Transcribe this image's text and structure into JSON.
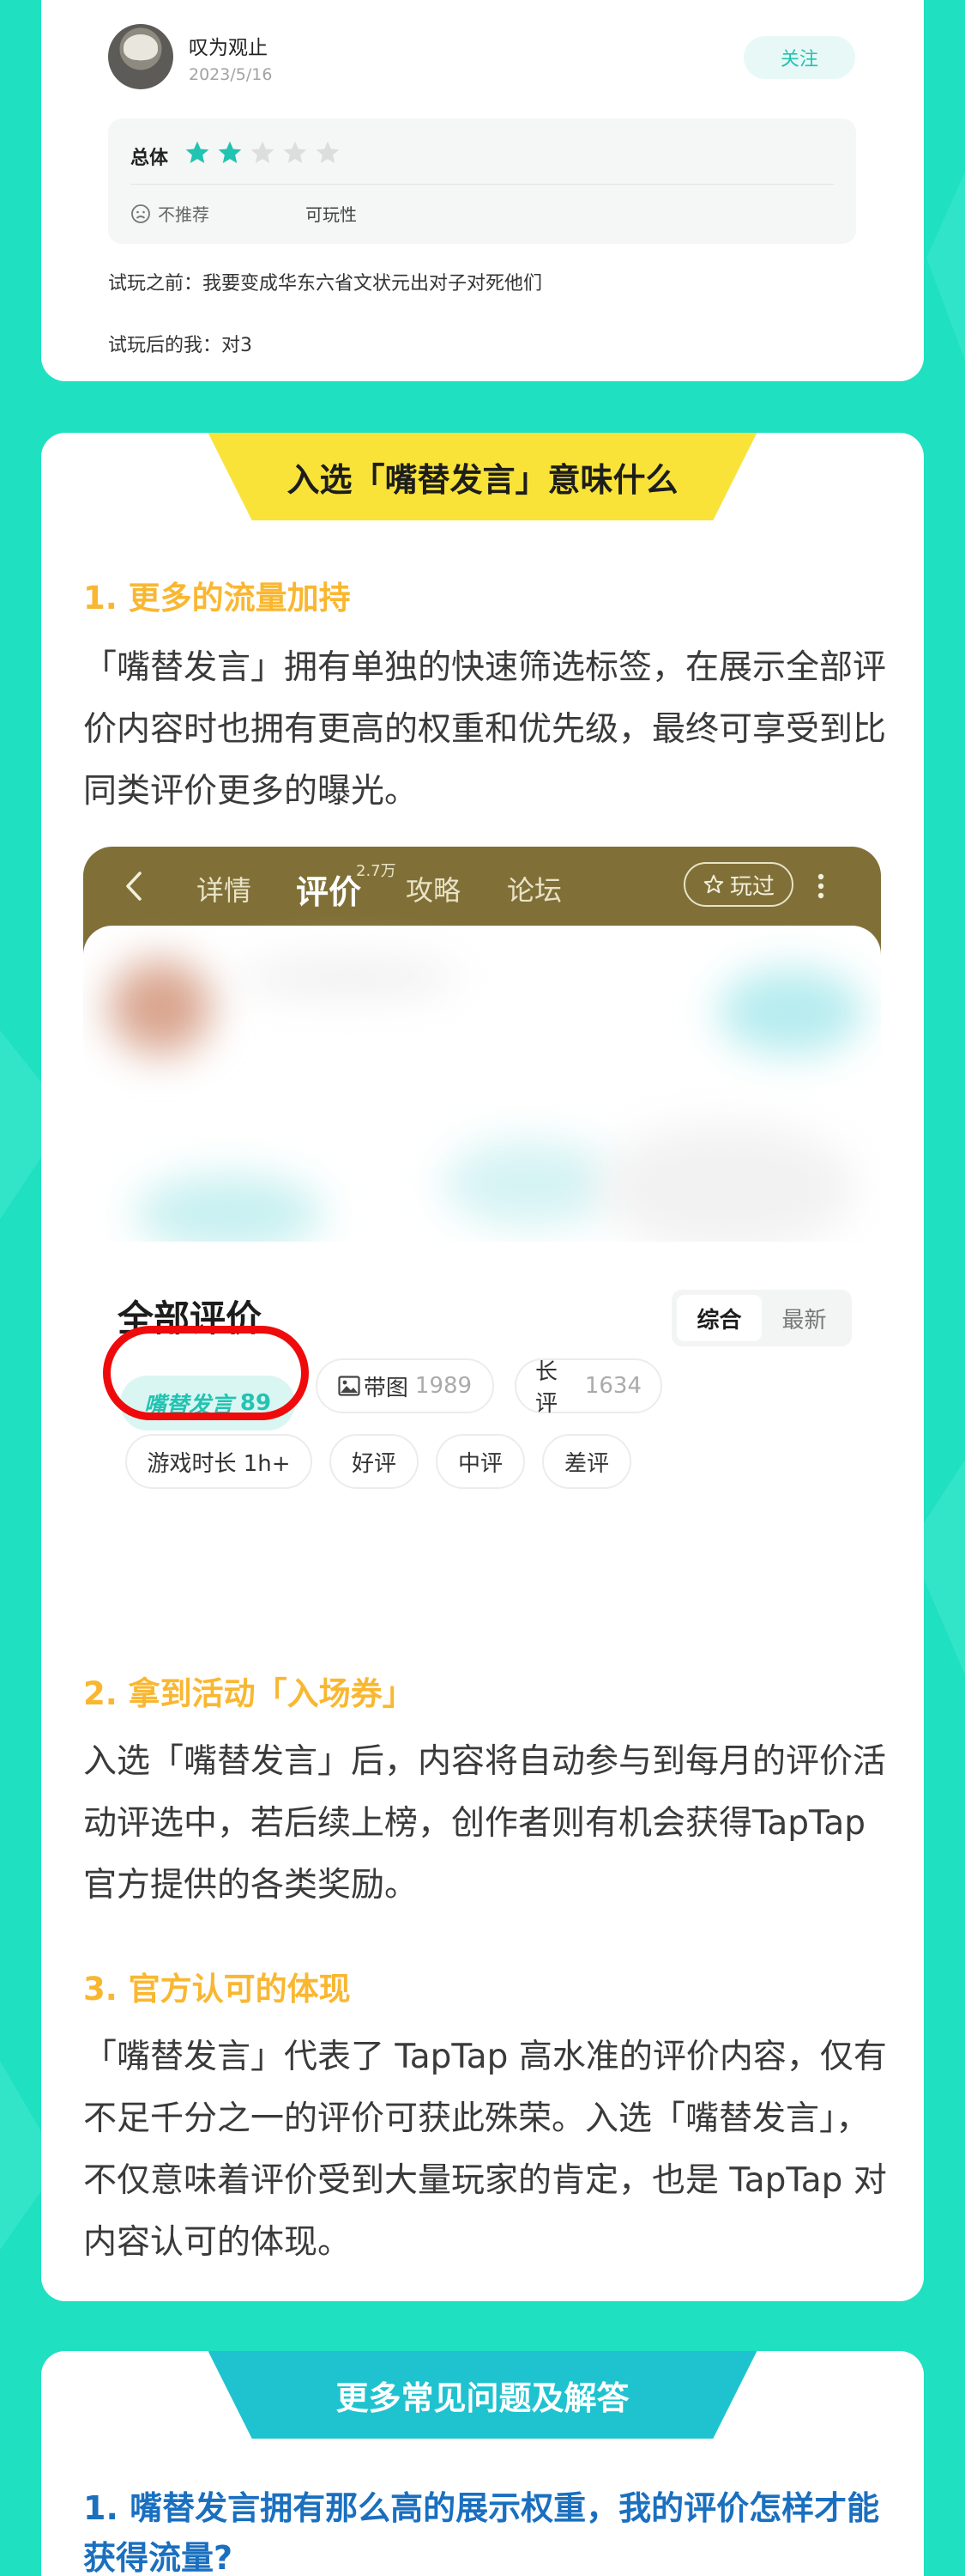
{
  "colors": {
    "background": "#1fe0c1",
    "accent_teal": "#22c3b1",
    "banner_yellow": "#f9e338",
    "banner_teal": "#1ec3cf",
    "section_title_orange": "#f9b731",
    "faq_blue": "#1a6fbf",
    "highlight_ring": "#ef0b0b",
    "embed_nav": "#807038"
  },
  "review": {
    "username": "叹为观止",
    "date": "2023/5/16",
    "follow_label": "关注",
    "overall_label": "总体",
    "rating": 2,
    "rating_max": 5,
    "recommend_label": "不推荐",
    "tag_label": "可玩性",
    "line1": "试玩之前：我要变成华东六省文状元出对子对死他们",
    "line2": "试玩后的我：对3"
  },
  "section_meaning": {
    "banner": "入选「嘴替发言」意味什么",
    "point1_title": "1. 更多的流量加持",
    "point1_body": "「嘴替发言」拥有单独的快速筛选标签，在展示全部评价内容时也拥有更高的权重和优先级，最终可享受到比同类评价更多的曝光。",
    "point2_title": "2. 拿到活动「入场券」",
    "point2_body": "入选「嘴替发言」后，内容将自动参与到每月的评价活动评选中，若后续上榜，创作者则有机会获得TapTap 官方提供的各类奖励。",
    "point3_title": "3. 官方认可的体现",
    "point3_body": "「嘴替发言」代表了 TapTap 高水准的评价内容，仅有不足千分之一的评价可获此殊荣。入选「嘴替发言」，不仅意味着评价受到大量玩家的肯定，也是 TapTap 对内容认可的体现。"
  },
  "embedded_screen": {
    "tabs": [
      "详情",
      "评价",
      "攻略",
      "论坛"
    ],
    "active_tab": "评价",
    "review_count_sup": "2.7万",
    "played_label": "玩过",
    "all_reviews_title": "全部评价",
    "sort_options": [
      "综合",
      "最新"
    ],
    "sort_active": "综合",
    "chips_row1": [
      {
        "label": "嘴替发言",
        "count": "89"
      },
      {
        "label": "带图",
        "count": "1989"
      },
      {
        "label": "长评",
        "count": "1634"
      }
    ],
    "chips_row2": [
      "游戏时长 1h+",
      "好评",
      "中评",
      "差评"
    ]
  },
  "section_faq": {
    "banner": "更多常见问题及解答",
    "q1": "1. 嘴替发言拥有那么高的展示权重，我的评价怎样才能获得流量?"
  }
}
